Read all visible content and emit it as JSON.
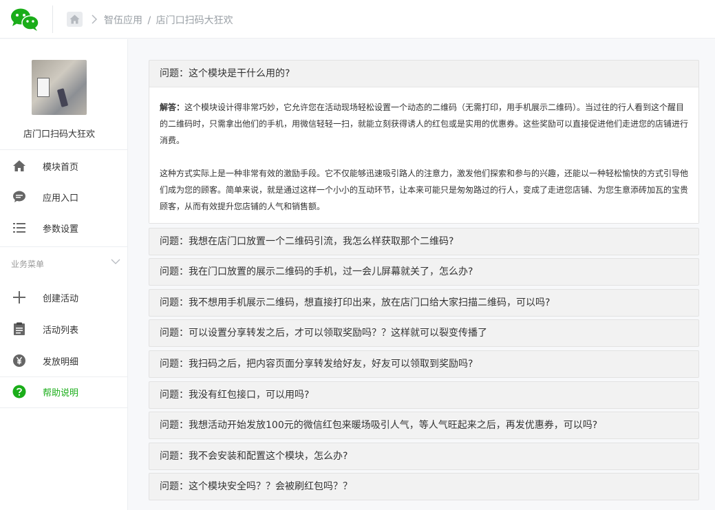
{
  "header": {
    "logo_icon": "wechat-logo-icon",
    "home_icon": "home-icon",
    "breadcrumb_app": "智伍应用",
    "breadcrumb_sep": "/",
    "breadcrumb_page": "店门口扫码大狂欢"
  },
  "sidebar": {
    "app_name": "店门口扫码大狂欢",
    "items_top": [
      {
        "label": "模块首页",
        "icon": "home-icon"
      },
      {
        "label": "应用入口",
        "icon": "chat-bubble-icon"
      },
      {
        "label": "参数设置",
        "icon": "list-settings-icon"
      }
    ],
    "section_title": "业务菜单",
    "items_business": [
      {
        "label": "创建活动",
        "icon": "plus-icon"
      },
      {
        "label": "活动列表",
        "icon": "clipboard-icon"
      },
      {
        "label": "发放明细",
        "icon": "yen-icon"
      },
      {
        "label": "帮助说明",
        "icon": "help-icon"
      }
    ],
    "accent_color": "#1aad19"
  },
  "faq": {
    "prefix": "问题：",
    "first": {
      "question": "这个模块是干什么用的?",
      "answer_label": "解答：",
      "answer_p1": "这个模块设计得非常巧妙，它允许您在活动现场轻松设置一个动态的二维码（无需打印，用手机展示二维码）。当过往的行人看到这个醒目的二维码时，只需拿出他们的手机，用微信轻轻一扫，就能立刻获得诱人的红包或是实用的优惠券。这些奖励可以直接促进他们走进您的店铺进行消费。",
      "answer_p2": "这种方式实际上是一种非常有效的激励手段。它不仅能够迅速吸引路人的注意力，激发他们探索和参与的兴趣，还能以一种轻松愉快的方式引导他们成为您的顾客。简单来说，就是通过这样一个小小的互动环节，让本来可能只是匆匆路过的行人，变成了走进您店铺、为您生意添砖加瓦的宝贵顾客，从而有效提升您店铺的人气和销售额。"
    },
    "questions": [
      "我想在店门口放置一个二维码引流，我怎么样获取那个二维码?",
      "我在门口放置的展示二维码的手机，过一会儿屏幕就关了，怎么办?",
      "我不想用手机展示二维码，想直接打印出来，放在店门口给大家扫描二维码，可以吗?",
      "可以设置分享转发之后，才可以领取奖励吗？？这样就可以裂变传播了",
      "我扫码之后，把内容页面分享转发给好友，好友可以领取到奖励吗?",
      "我没有红包接口，可以用吗?",
      "我想活动开始发放100元的微信红包来暖场吸引人气，等人气旺起来之后，再发优惠券，可以吗?",
      "我不会安装和配置这个模块，怎么办?",
      "这个模块安全吗？？会被刷红包吗？？"
    ]
  }
}
